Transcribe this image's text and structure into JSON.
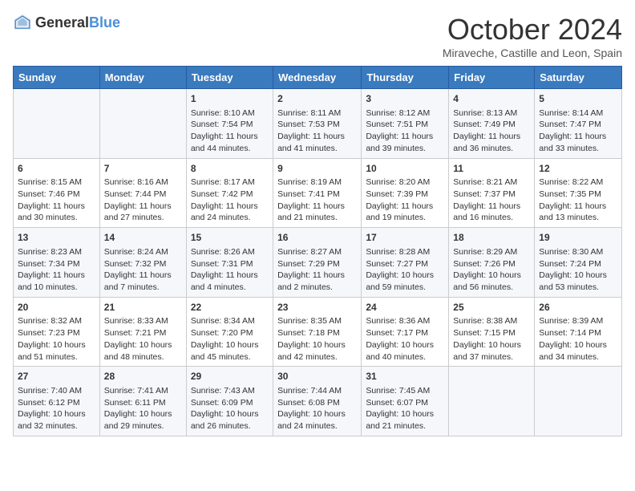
{
  "header": {
    "logo_general": "General",
    "logo_blue": "Blue",
    "month_title": "October 2024",
    "location": "Miraveche, Castille and Leon, Spain"
  },
  "weekdays": [
    "Sunday",
    "Monday",
    "Tuesday",
    "Wednesday",
    "Thursday",
    "Friday",
    "Saturday"
  ],
  "weeks": [
    [
      {
        "day": "",
        "sunrise": "",
        "sunset": "",
        "daylight": ""
      },
      {
        "day": "",
        "sunrise": "",
        "sunset": "",
        "daylight": ""
      },
      {
        "day": "1",
        "sunrise": "Sunrise: 8:10 AM",
        "sunset": "Sunset: 7:54 PM",
        "daylight": "Daylight: 11 hours and 44 minutes."
      },
      {
        "day": "2",
        "sunrise": "Sunrise: 8:11 AM",
        "sunset": "Sunset: 7:53 PM",
        "daylight": "Daylight: 11 hours and 41 minutes."
      },
      {
        "day": "3",
        "sunrise": "Sunrise: 8:12 AM",
        "sunset": "Sunset: 7:51 PM",
        "daylight": "Daylight: 11 hours and 39 minutes."
      },
      {
        "day": "4",
        "sunrise": "Sunrise: 8:13 AM",
        "sunset": "Sunset: 7:49 PM",
        "daylight": "Daylight: 11 hours and 36 minutes."
      },
      {
        "day": "5",
        "sunrise": "Sunrise: 8:14 AM",
        "sunset": "Sunset: 7:47 PM",
        "daylight": "Daylight: 11 hours and 33 minutes."
      }
    ],
    [
      {
        "day": "6",
        "sunrise": "Sunrise: 8:15 AM",
        "sunset": "Sunset: 7:46 PM",
        "daylight": "Daylight: 11 hours and 30 minutes."
      },
      {
        "day": "7",
        "sunrise": "Sunrise: 8:16 AM",
        "sunset": "Sunset: 7:44 PM",
        "daylight": "Daylight: 11 hours and 27 minutes."
      },
      {
        "day": "8",
        "sunrise": "Sunrise: 8:17 AM",
        "sunset": "Sunset: 7:42 PM",
        "daylight": "Daylight: 11 hours and 24 minutes."
      },
      {
        "day": "9",
        "sunrise": "Sunrise: 8:19 AM",
        "sunset": "Sunset: 7:41 PM",
        "daylight": "Daylight: 11 hours and 21 minutes."
      },
      {
        "day": "10",
        "sunrise": "Sunrise: 8:20 AM",
        "sunset": "Sunset: 7:39 PM",
        "daylight": "Daylight: 11 hours and 19 minutes."
      },
      {
        "day": "11",
        "sunrise": "Sunrise: 8:21 AM",
        "sunset": "Sunset: 7:37 PM",
        "daylight": "Daylight: 11 hours and 16 minutes."
      },
      {
        "day": "12",
        "sunrise": "Sunrise: 8:22 AM",
        "sunset": "Sunset: 7:35 PM",
        "daylight": "Daylight: 11 hours and 13 minutes."
      }
    ],
    [
      {
        "day": "13",
        "sunrise": "Sunrise: 8:23 AM",
        "sunset": "Sunset: 7:34 PM",
        "daylight": "Daylight: 11 hours and 10 minutes."
      },
      {
        "day": "14",
        "sunrise": "Sunrise: 8:24 AM",
        "sunset": "Sunset: 7:32 PM",
        "daylight": "Daylight: 11 hours and 7 minutes."
      },
      {
        "day": "15",
        "sunrise": "Sunrise: 8:26 AM",
        "sunset": "Sunset: 7:31 PM",
        "daylight": "Daylight: 11 hours and 4 minutes."
      },
      {
        "day": "16",
        "sunrise": "Sunrise: 8:27 AM",
        "sunset": "Sunset: 7:29 PM",
        "daylight": "Daylight: 11 hours and 2 minutes."
      },
      {
        "day": "17",
        "sunrise": "Sunrise: 8:28 AM",
        "sunset": "Sunset: 7:27 PM",
        "daylight": "Daylight: 10 hours and 59 minutes."
      },
      {
        "day": "18",
        "sunrise": "Sunrise: 8:29 AM",
        "sunset": "Sunset: 7:26 PM",
        "daylight": "Daylight: 10 hours and 56 minutes."
      },
      {
        "day": "19",
        "sunrise": "Sunrise: 8:30 AM",
        "sunset": "Sunset: 7:24 PM",
        "daylight": "Daylight: 10 hours and 53 minutes."
      }
    ],
    [
      {
        "day": "20",
        "sunrise": "Sunrise: 8:32 AM",
        "sunset": "Sunset: 7:23 PM",
        "daylight": "Daylight: 10 hours and 51 minutes."
      },
      {
        "day": "21",
        "sunrise": "Sunrise: 8:33 AM",
        "sunset": "Sunset: 7:21 PM",
        "daylight": "Daylight: 10 hours and 48 minutes."
      },
      {
        "day": "22",
        "sunrise": "Sunrise: 8:34 AM",
        "sunset": "Sunset: 7:20 PM",
        "daylight": "Daylight: 10 hours and 45 minutes."
      },
      {
        "day": "23",
        "sunrise": "Sunrise: 8:35 AM",
        "sunset": "Sunset: 7:18 PM",
        "daylight": "Daylight: 10 hours and 42 minutes."
      },
      {
        "day": "24",
        "sunrise": "Sunrise: 8:36 AM",
        "sunset": "Sunset: 7:17 PM",
        "daylight": "Daylight: 10 hours and 40 minutes."
      },
      {
        "day": "25",
        "sunrise": "Sunrise: 8:38 AM",
        "sunset": "Sunset: 7:15 PM",
        "daylight": "Daylight: 10 hours and 37 minutes."
      },
      {
        "day": "26",
        "sunrise": "Sunrise: 8:39 AM",
        "sunset": "Sunset: 7:14 PM",
        "daylight": "Daylight: 10 hours and 34 minutes."
      }
    ],
    [
      {
        "day": "27",
        "sunrise": "Sunrise: 7:40 AM",
        "sunset": "Sunset: 6:12 PM",
        "daylight": "Daylight: 10 hours and 32 minutes."
      },
      {
        "day": "28",
        "sunrise": "Sunrise: 7:41 AM",
        "sunset": "Sunset: 6:11 PM",
        "daylight": "Daylight: 10 hours and 29 minutes."
      },
      {
        "day": "29",
        "sunrise": "Sunrise: 7:43 AM",
        "sunset": "Sunset: 6:09 PM",
        "daylight": "Daylight: 10 hours and 26 minutes."
      },
      {
        "day": "30",
        "sunrise": "Sunrise: 7:44 AM",
        "sunset": "Sunset: 6:08 PM",
        "daylight": "Daylight: 10 hours and 24 minutes."
      },
      {
        "day": "31",
        "sunrise": "Sunrise: 7:45 AM",
        "sunset": "Sunset: 6:07 PM",
        "daylight": "Daylight: 10 hours and 21 minutes."
      },
      {
        "day": "",
        "sunrise": "",
        "sunset": "",
        "daylight": ""
      },
      {
        "day": "",
        "sunrise": "",
        "sunset": "",
        "daylight": ""
      }
    ]
  ]
}
